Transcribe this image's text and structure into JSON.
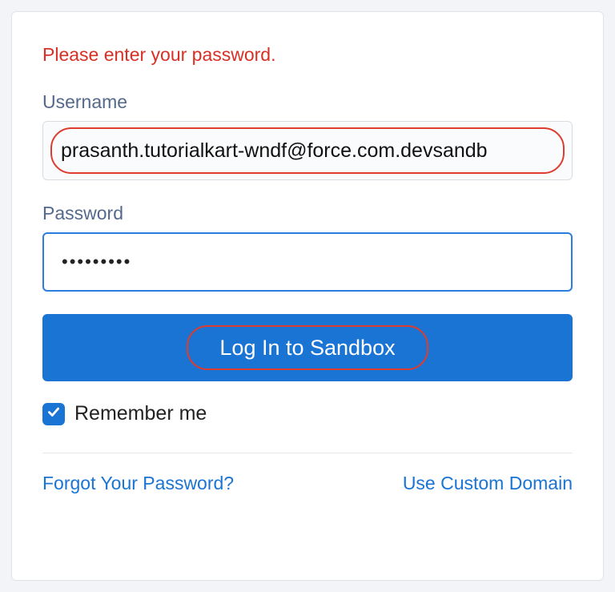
{
  "error_message": "Please enter your password.",
  "form": {
    "username_label": "Username",
    "username_value": "prasanth.tutorialkart-wndf@force.com.devsandb",
    "password_label": "Password",
    "password_masked": "•••••••••",
    "submit_label": "Log In to Sandbox",
    "remember_label": "Remember me",
    "remember_checked": true
  },
  "links": {
    "forgot_password": "Forgot Your Password?",
    "custom_domain": "Use Custom Domain"
  },
  "colors": {
    "primary": "#1a74d3",
    "error": "#d93025",
    "highlight_ring": "#de3c2e"
  }
}
